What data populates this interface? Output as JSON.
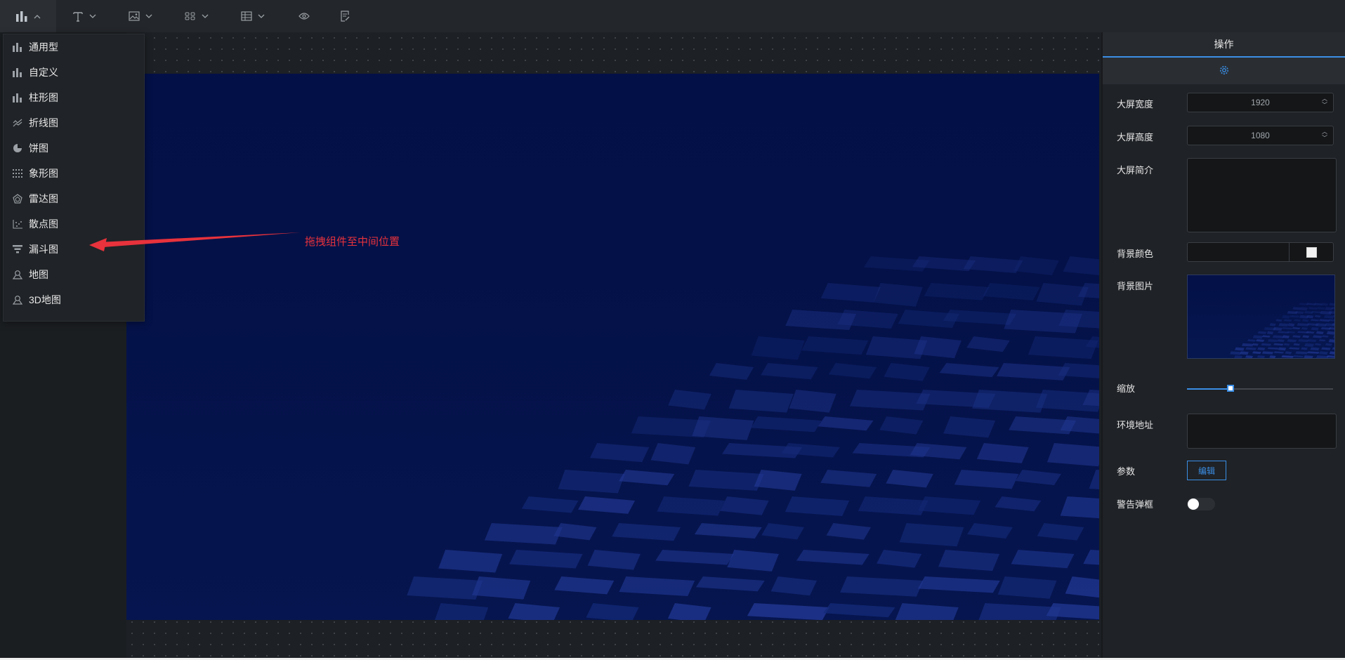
{
  "toolbar": {
    "items": [
      {
        "name": "chart-menu-button",
        "icon": "bar-chart-icon",
        "open": true
      },
      {
        "name": "text-menu-button",
        "icon": "text-icon"
      },
      {
        "name": "image-menu-button",
        "icon": "image-icon"
      },
      {
        "name": "component-menu-button",
        "icon": "grid-component-icon"
      },
      {
        "name": "table-menu-button",
        "icon": "table-icon"
      },
      {
        "name": "preview-button",
        "icon": "eye-icon"
      },
      {
        "name": "save-button",
        "icon": "document-edit-icon"
      }
    ]
  },
  "chart_menu": {
    "items": [
      {
        "label": "通用型",
        "icon": "bar-chart-icon"
      },
      {
        "label": "自定义",
        "icon": "bar-chart-icon"
      },
      {
        "label": "柱形图",
        "icon": "bar-chart-icon"
      },
      {
        "label": "折线图",
        "icon": "line-chart-icon"
      },
      {
        "label": "饼图",
        "icon": "pie-chart-icon"
      },
      {
        "label": "象形图",
        "icon": "pictorial-chart-icon"
      },
      {
        "label": "雷达图",
        "icon": "radar-chart-icon"
      },
      {
        "label": "散点图",
        "icon": "scatter-chart-icon"
      },
      {
        "label": "漏斗图",
        "icon": "funnel-chart-icon"
      },
      {
        "label": "地图",
        "icon": "map-pin-icon"
      },
      {
        "label": "3D地图",
        "icon": "map-pin-icon"
      }
    ]
  },
  "annotation": {
    "text": "拖拽组件至中间位置",
    "color": "#e8323c"
  },
  "panel": {
    "title": "操作",
    "tab_icon": "gear-icon",
    "width_label": "大屏宽度",
    "width_value": "1920",
    "height_label": "大屏高度",
    "height_value": "1080",
    "desc_label": "大屏简介",
    "desc_value": "",
    "bg_color_label": "背景颜色",
    "bg_color_value": "",
    "bg_image_label": "背景图片",
    "zoom_label": "缩放",
    "zoom_fraction": 0.3,
    "env_label": "环境地址",
    "env_value": "",
    "params_label": "参数",
    "edit_label": "编辑",
    "alert_label": "警告弹框",
    "alert_enabled": false
  },
  "colors": {
    "accent": "#3a8ee6",
    "canvas_bg": "#031047",
    "panel_bg": "#1f2226"
  }
}
